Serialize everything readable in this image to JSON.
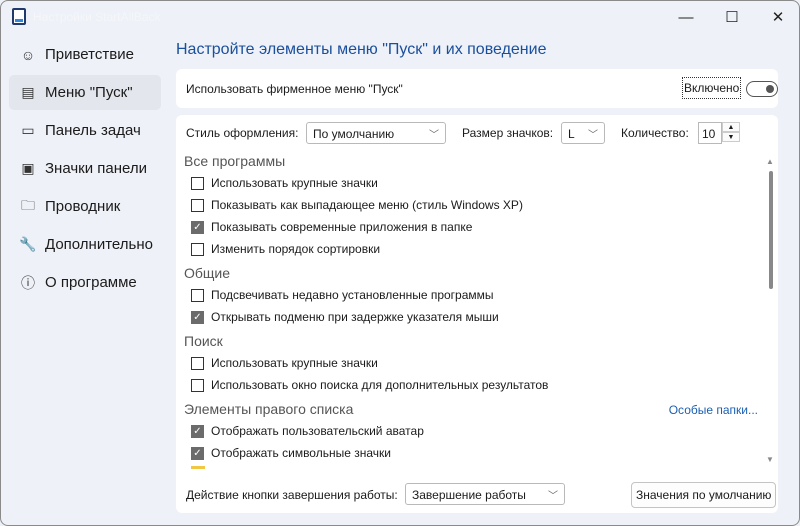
{
  "window": {
    "title": "Настройки StartAllBack",
    "minimize": "—",
    "maximize": "☐",
    "close": "✕"
  },
  "sidebar": {
    "items": [
      {
        "icon": "☺",
        "label": "Приветствие"
      },
      {
        "icon": "▤",
        "label": "Меню \"Пуск\""
      },
      {
        "icon": "▭",
        "label": "Панель задач"
      },
      {
        "icon": "▣",
        "label": "Значки панели"
      },
      {
        "icon": "🗀",
        "label": "Проводник"
      },
      {
        "icon": "🔧",
        "label": "Дополнительно"
      },
      {
        "icon": "ⓘ",
        "label": "О программе"
      }
    ]
  },
  "heading": "Настройте элементы меню \"Пуск\" и их поведение",
  "branded_menu": {
    "label": "Использовать фирменное меню \"Пуск\"",
    "state_label": "Включено",
    "enabled": true
  },
  "options": {
    "style_label": "Стиль оформления:",
    "style_value": "По умолчанию",
    "icon_size_label": "Размер значков:",
    "icon_size_value": "L",
    "count_label": "Количество:",
    "count_value": "10"
  },
  "sections": {
    "all_programs": {
      "title": "Все программы",
      "items": [
        {
          "label": "Использовать крупные значки",
          "checked": false
        },
        {
          "label": "Показывать как выпадающее меню (стиль Windows XP)",
          "checked": false
        },
        {
          "label": "Показывать современные приложения в папке",
          "checked": true
        },
        {
          "label": "Изменить порядок сортировки",
          "checked": false
        }
      ]
    },
    "general": {
      "title": "Общие",
      "items": [
        {
          "label": "Подсвечивать недавно установленные программы",
          "checked": false
        },
        {
          "label": "Открывать подменю при задержке указателя мыши",
          "checked": true
        }
      ]
    },
    "search": {
      "title": "Поиск",
      "items": [
        {
          "label": "Использовать крупные значки",
          "checked": false
        },
        {
          "label": "Использовать окно поиска для дополнительных результатов",
          "checked": false
        }
      ]
    },
    "right_list": {
      "title": "Элементы правого списка",
      "link": "Особые папки...",
      "items": [
        {
          "label": "Отображать пользовательский аватар",
          "checked": true
        },
        {
          "label": "Отображать символьные значки",
          "checked": true
        }
      ]
    }
  },
  "footer": {
    "shutdown_label": "Действие кнопки завершения работы:",
    "shutdown_value": "Завершение работы",
    "defaults_button": "Значения по умолчанию"
  }
}
